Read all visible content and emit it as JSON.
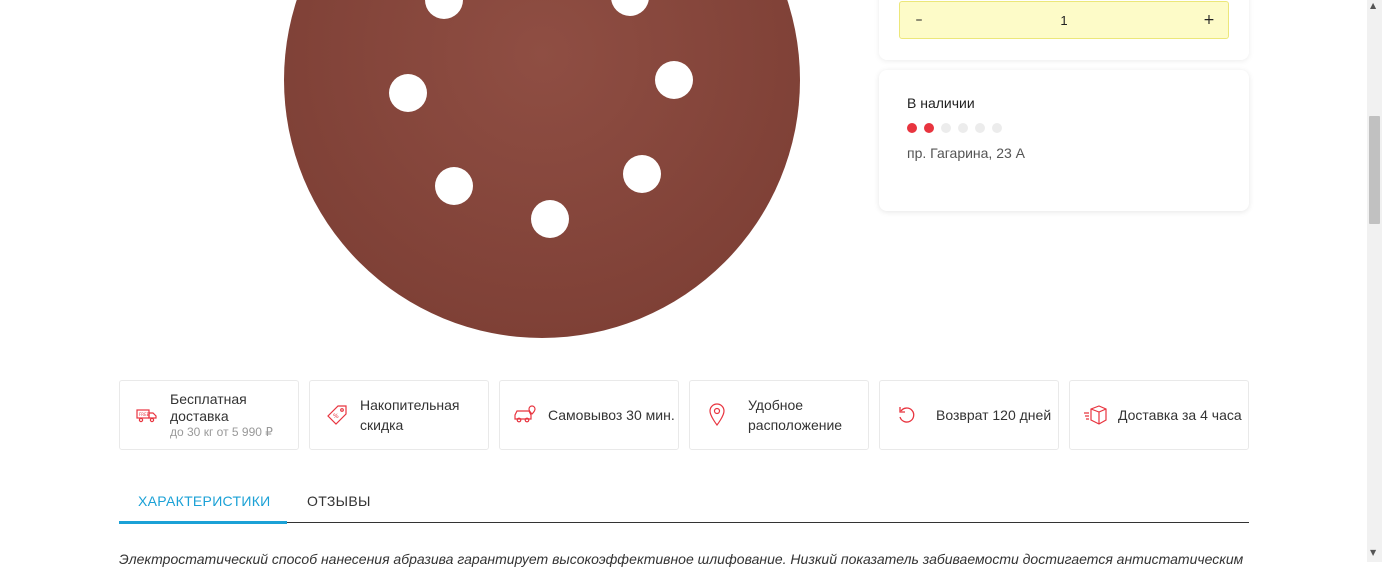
{
  "quantity": {
    "minus_label": "–",
    "value": "1",
    "plus_label": "+"
  },
  "stock": {
    "title": "В наличии",
    "level_filled": 2,
    "level_total": 6,
    "address": "пр. Гагарина, 23 А"
  },
  "benefits": [
    {
      "icon": "truck-free-icon",
      "label": "Бесплатная доставка",
      "sub": "до 30 кг от 5 990 ₽"
    },
    {
      "icon": "discount-tag-icon",
      "label": "Накопительная скидка"
    },
    {
      "icon": "car-pickup-icon",
      "label": "Самовывоз 30 мин."
    },
    {
      "icon": "location-pin-icon",
      "label": "Удобное расположение"
    },
    {
      "icon": "return-arrow-icon",
      "label": "Возврат 120 дней"
    },
    {
      "icon": "box-delivery-icon",
      "label": "Доставка за 4 часа"
    }
  ],
  "tabs": [
    {
      "label": "ХАРАКТЕРИСТИКИ",
      "active": true
    },
    {
      "label": "ОТЗЫВЫ",
      "active": false
    }
  ],
  "description": "Электростатический способ нанесения абразива гарантирует высокоэффективное шлифование. Низкий показатель забиваемости достигается антистатическим",
  "colors": {
    "accent": "#1ba1d6",
    "stock_on": "#e8343f",
    "icon_red": "#e8343f",
    "qty_bg": "#fdfbc8",
    "disc": "#8b4a3e"
  }
}
